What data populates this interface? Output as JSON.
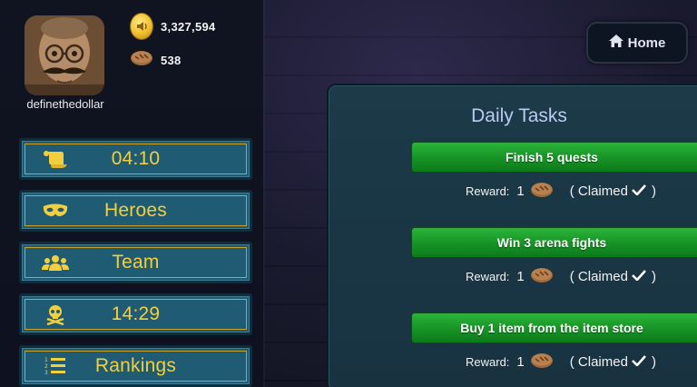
{
  "player": {
    "username": "definethedollar",
    "gold": "3,327,594",
    "bread": "538"
  },
  "menu": [
    {
      "label": "04:10",
      "icon": "scroll-icon"
    },
    {
      "label": "Heroes",
      "icon": "mask-icon"
    },
    {
      "label": "Team",
      "icon": "users-icon"
    },
    {
      "label": "14:29",
      "icon": "skull-crossbones-icon"
    },
    {
      "label": "Rankings",
      "icon": "numbered-list-icon"
    }
  ],
  "home_button": {
    "label": "Home",
    "icon": "home-icon"
  },
  "daily_tasks": {
    "title": "Daily Tasks",
    "tasks": [
      {
        "name": "Finish 5 quests",
        "reward_label": "Reward:",
        "reward_amount": "1",
        "status": "( Claimed",
        "status_end": ")"
      },
      {
        "name": "Win 3 arena fights",
        "reward_label": "Reward:",
        "reward_amount": "1",
        "status": "( Claimed",
        "status_end": ")"
      },
      {
        "name": "Buy 1 item from the item store",
        "reward_label": "Reward:",
        "reward_amount": "1",
        "status": "( Claimed",
        "status_end": ")"
      }
    ]
  },
  "colors": {
    "menu_bg": "#1f5b72",
    "menu_text": "#f3cf3d",
    "task_green": "#169225",
    "panel_bg": "#1c3a48"
  }
}
